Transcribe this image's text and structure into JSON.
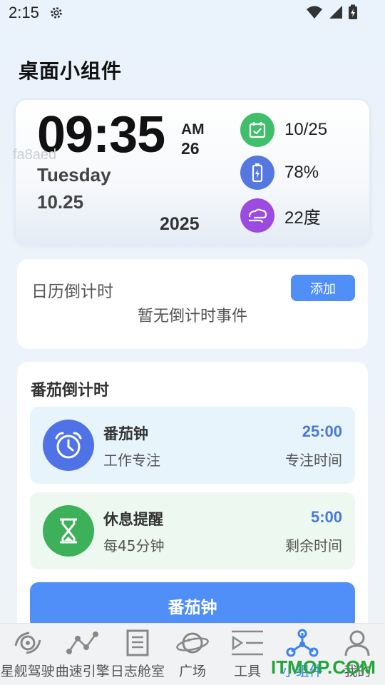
{
  "status_bar": {
    "time": "2:15"
  },
  "page_title": "桌面小组件",
  "widget": {
    "time": "09:35",
    "ampm": "AM",
    "seconds": "26",
    "color_tag": "fa8aed",
    "weekday": "Tuesday",
    "month_day": "10.25",
    "year": "2025",
    "info": [
      {
        "icon": "calendar-check-icon",
        "text": "10/25",
        "color": "#3fbf6a"
      },
      {
        "icon": "battery-charging-icon",
        "text": "78%",
        "color": "#5577e0"
      },
      {
        "icon": "weather-wind-icon",
        "text": "22度",
        "color": "#9c4be0"
      }
    ]
  },
  "calendar_countdown": {
    "title": "日历倒计时",
    "add_label": "添加",
    "empty_text": "暂无倒计时事件"
  },
  "pomodoro": {
    "title": "番茄倒计时",
    "items": [
      {
        "name": "番茄钟",
        "sub": "工作专注",
        "value": "25:00",
        "value_label": "专注时间",
        "icon": "alarm-clock-icon",
        "color": "#4f73e6"
      },
      {
        "name": "休息提醒",
        "sub": "每45分钟",
        "value": "5:00",
        "value_label": "剩余时间",
        "icon": "hourglass-icon",
        "color": "#3db05a"
      }
    ],
    "start_label": "番茄钟"
  },
  "nav": {
    "items": [
      {
        "label": "星舰驾驶",
        "icon": "spaceship-icon"
      },
      {
        "label": "曲速引擎",
        "icon": "network-icon"
      },
      {
        "label": "日志舱室",
        "icon": "log-icon"
      },
      {
        "label": "广场",
        "icon": "planet-icon"
      },
      {
        "label": "工具",
        "icon": "tools-icon"
      },
      {
        "label": "小组件",
        "icon": "widget-nodes-icon"
      },
      {
        "label": "我的",
        "icon": "profile-icon"
      }
    ],
    "active_index": 5
  },
  "watermark": "ITMOP.COM",
  "colors": {
    "accent": "#4f8ff7",
    "active_nav": "#3c82f0"
  }
}
